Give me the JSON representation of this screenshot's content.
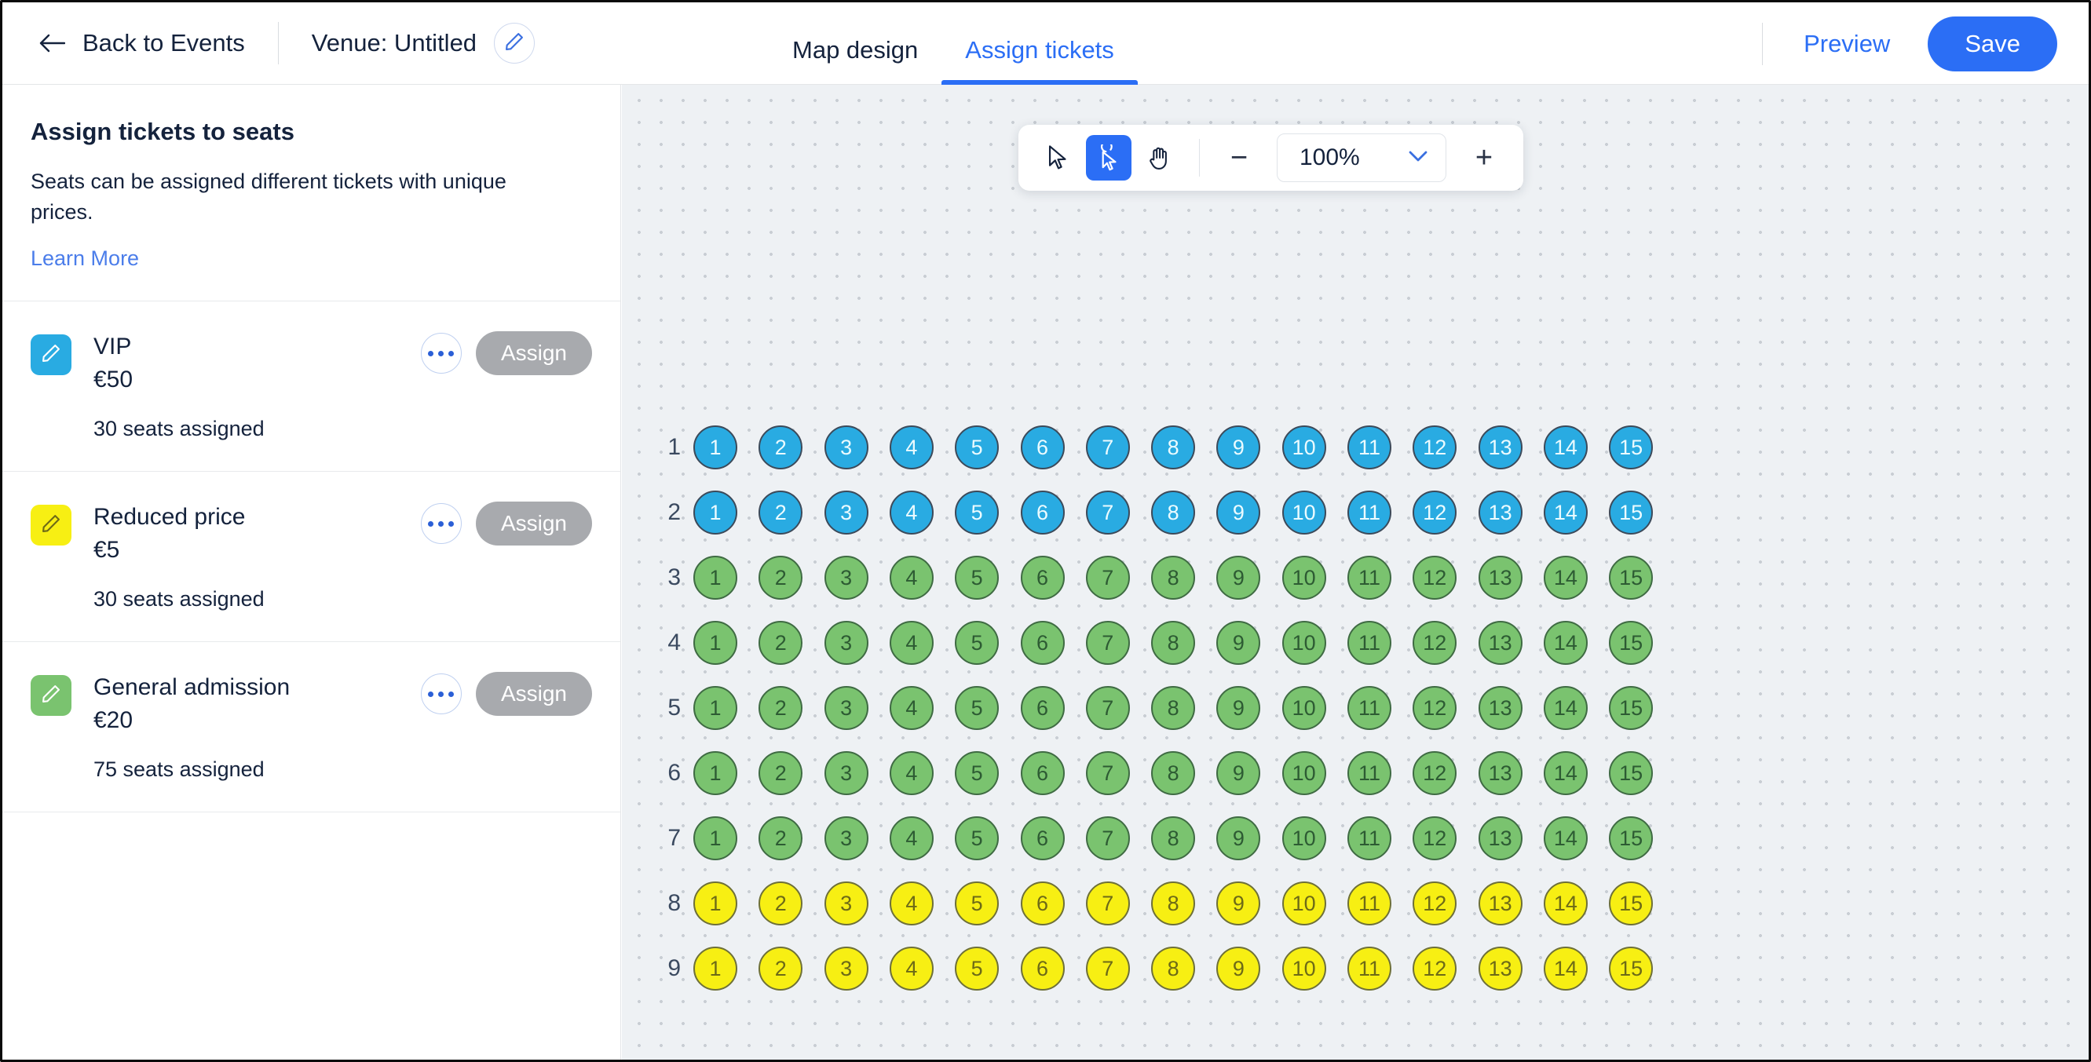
{
  "header": {
    "back_label": "Back to Events",
    "venue_label": "Venue: Untitled",
    "edit_venue_icon": "pencil-icon",
    "tabs": [
      {
        "label": "Map design",
        "active": false
      },
      {
        "label": "Assign tickets",
        "active": true
      }
    ],
    "preview_label": "Preview",
    "save_label": "Save"
  },
  "sidebar": {
    "title": "Assign tickets to seats",
    "description": "Seats can be assigned different tickets with unique prices.",
    "learn_more_label": "Learn More",
    "tickets": [
      {
        "name": "VIP",
        "price": "€50",
        "seats_assigned": "30 seats assigned",
        "color": "#29abe2",
        "menu_label": "...",
        "assign_label": "Assign"
      },
      {
        "name": "Reduced price",
        "price": "€5",
        "seats_assigned": "30 seats assigned",
        "color": "#f7ef13",
        "menu_label": "...",
        "assign_label": "Assign"
      },
      {
        "name": "General admission",
        "price": "€20",
        "seats_assigned": "75 seats assigned",
        "color": "#7ac36f",
        "menu_label": "...",
        "assign_label": "Assign"
      }
    ]
  },
  "canvas": {
    "toolbar": {
      "select_tool_icon": "cursor-arrow-icon",
      "click_tool_icon": "cursor-click-icon",
      "pan_tool_icon": "hand-icon",
      "active_tool": "cursor-click-icon",
      "zoom_out_label": "−",
      "zoom_value": "100%",
      "zoom_in_label": "+",
      "chevron_icon": "chevron-down-icon"
    },
    "seatmap": {
      "row_labels": [
        "1",
        "2",
        "3",
        "4",
        "5",
        "6",
        "7",
        "8",
        "9"
      ],
      "seat_numbers": [
        "1",
        "2",
        "3",
        "4",
        "5",
        "6",
        "7",
        "8",
        "9",
        "10",
        "11",
        "12",
        "13",
        "14",
        "15"
      ],
      "row_colors": [
        "blue",
        "blue",
        "green",
        "green",
        "green",
        "green",
        "green",
        "yellow",
        "yellow"
      ],
      "seats_per_row": 15,
      "total_rows": 9
    }
  },
  "colors": {
    "accent": "#2b6ef5",
    "vip": "#29abe2",
    "reduced": "#f7ef13",
    "general": "#7ac36f",
    "assign_button": "#a8aaae",
    "canvas_bg": "#eef1f4"
  }
}
